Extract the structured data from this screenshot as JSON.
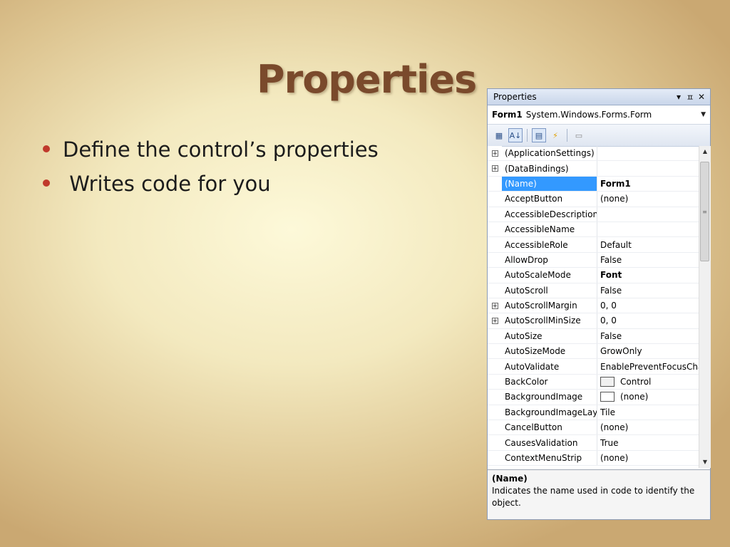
{
  "slide": {
    "title": "Properties",
    "bullets": [
      "Define the control’s properties",
      " Writes code for you"
    ]
  },
  "panel": {
    "title": "Properties",
    "title_icons": [
      "dropdown-icon",
      "pin-icon",
      "close-icon"
    ],
    "object": {
      "name": "Form1",
      "type": "System.Windows.Forms.Form"
    },
    "toolbar": [
      "categorized-icon",
      "alphabetical-icon",
      "properties-icon",
      "events-icon",
      "property-pages-icon"
    ],
    "rows": [
      {
        "name": "(ApplicationSettings)",
        "value": "",
        "expand": true
      },
      {
        "name": "(DataBindings)",
        "value": "",
        "expand": true
      },
      {
        "name": "(Name)",
        "value": "Form1",
        "selected": true,
        "bold": true
      },
      {
        "name": "AcceptButton",
        "value": "(none)"
      },
      {
        "name": "AccessibleDescription",
        "value": ""
      },
      {
        "name": "AccessibleName",
        "value": ""
      },
      {
        "name": "AccessibleRole",
        "value": "Default"
      },
      {
        "name": "AllowDrop",
        "value": "False"
      },
      {
        "name": "AutoScaleMode",
        "value": "Font",
        "bold": true
      },
      {
        "name": "AutoScroll",
        "value": "False"
      },
      {
        "name": "AutoScrollMargin",
        "value": "0, 0",
        "expand": true
      },
      {
        "name": "AutoScrollMinSize",
        "value": "0, 0",
        "expand": true
      },
      {
        "name": "AutoSize",
        "value": "False"
      },
      {
        "name": "AutoSizeMode",
        "value": "GrowOnly"
      },
      {
        "name": "AutoValidate",
        "value": "EnablePreventFocusChange"
      },
      {
        "name": "BackColor",
        "value": "Control",
        "swatch": "#f0f0f0"
      },
      {
        "name": "BackgroundImage",
        "value": "(none)",
        "swatch": "#ffffff"
      },
      {
        "name": "BackgroundImageLayout",
        "value": "Tile"
      },
      {
        "name": "CancelButton",
        "value": "(none)"
      },
      {
        "name": "CausesValidation",
        "value": "True"
      },
      {
        "name": "ContextMenuStrip",
        "value": "(none)"
      }
    ],
    "description": {
      "title": "(Name)",
      "text": "Indicates the name used in code to identify the object."
    }
  },
  "colors": {
    "selection": "#3399ff",
    "title": "#7a4a2c",
    "bullet": "#c0392b"
  }
}
